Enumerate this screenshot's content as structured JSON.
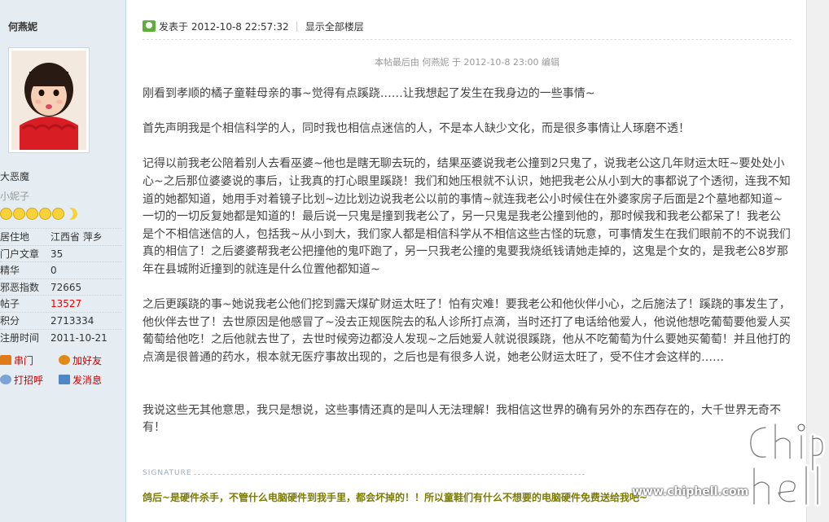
{
  "sidebar": {
    "author": "何燕妮",
    "group": "大恶魔",
    "custom_title": "小妮子",
    "stats": [
      {
        "key": "居住地",
        "value": "江西省 萍乡",
        "highlight": false
      },
      {
        "key": "门户文章",
        "value": "35",
        "highlight": false
      },
      {
        "key": "精华",
        "value": "0",
        "highlight": false
      },
      {
        "key": "邪恶指数",
        "value": "72665",
        "highlight": false
      },
      {
        "key": "帖子",
        "value": "13527",
        "highlight": true
      },
      {
        "key": "积分",
        "value": "2713334",
        "highlight": false
      },
      {
        "key": "注册时间",
        "value": "2011-10-21",
        "highlight": false
      }
    ],
    "actions": {
      "home": "串门",
      "add_friend": "加好友",
      "greet": "打招呼",
      "message": "发消息"
    }
  },
  "post": {
    "posted_at": "发表于 2012-10-8 22:57:32",
    "show_all": "显示全部楼层",
    "edit_note": "本帖最后由 何燕妮 于 2012-10-8 23:00 编辑",
    "paragraphs": [
      "刚看到孝顺的橘子童鞋母亲的事~觉得有点蹊跷……让我想起了发生在我身边的一些事情~",
      "首先声明我是个相信科学的人，同时我也相信点迷信的人，不是本人缺少文化，而是很多事情让人琢磨不透！",
      "记得以前我老公陪着别人去看巫婆~他也是瞎无聊去玩的，结果巫婆说我老公撞到2只鬼了，说我老公这几年财运太旺~要处处小心~之后那位婆婆说的事后，让我真的打心眼里蹊跷！我们和她压根就不认识，她把我老公从小到大的事都说了个透彻，连我不知道的她都知道，她用手对着镜子比划~边比划边说我老公以前的事情~就连我老公小时候住在外婆家房子后面是2个墓地都知道~一切的一切反复她都是知道的！最后说一只鬼是撞到我老公了，另一只鬼是我老公撞到他的，那时候我和我老公都呆了！我老公是个不相信迷信的人，包括我~从小到大，我们家人都是相信科学从不相信这些古怪的玩意，可事情发生在我们眼前不的不说我们真的相信了！之后婆婆帮我老公把撞他的鬼吓跑了，另一只我老公撞的鬼要我烧纸钱请她走掉的，这鬼是个女的，是我老公8岁那年在县城附近撞到的就连是什么位置他都知道~",
      "之后更蹊跷的事~她说我老公他们挖到露天煤矿财运太旺了！怕有灾难！要我老公和他伙伴小心，之后施法了！蹊跷的事发生了，他伙伴去世了！去世原因是他感冒了~没去正规医院去的私人诊所打点滴，当时还打了电话给他爱人，他说他想吃葡萄要他爱人买葡萄给他吃！之后他就去世了，去世时候旁边都没人发现~之后她爱人就说很蹊跷，他从不吃葡萄为什么要她买葡萄！并且他打的点滴是很普通的药水，根本就无医疗事故出现的，之后也是有很多人说，她老公财运太旺了，受不住才会这样的……",
      "我说这些无其他意思，我只是想说，这些事情还真的是叫人无法理解！我相信这世界的确有另外的东西存在的，大千世界无奇不有！"
    ],
    "signature_label": "SIGNATURE",
    "signature": "鸽后~是硬件杀手，不管什么电脑硬件到我手里，都会坏掉的！！所以童鞋们有什么不想要的电脑硬件免费送给我吧~"
  },
  "watermark": {
    "logo": "chip hell",
    "url": "www.chiphell.com"
  }
}
